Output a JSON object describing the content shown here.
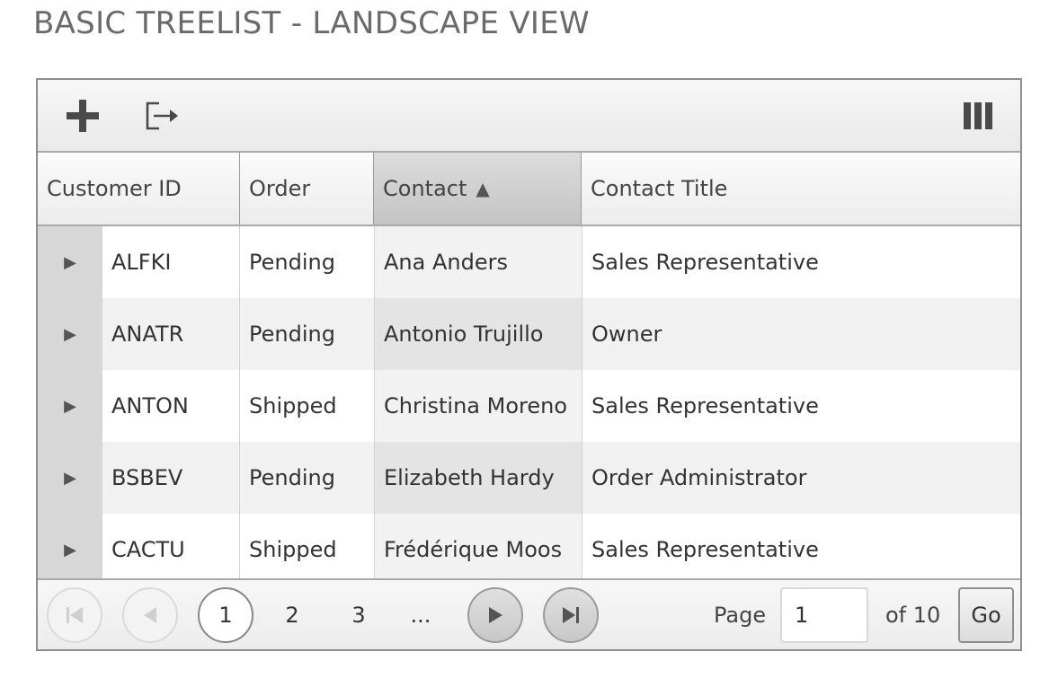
{
  "page": {
    "title": "BASIC TREELIST - LANDSCAPE VIEW"
  },
  "toolbar": {
    "add_icon": "plus-icon",
    "export_icon": "export-icon",
    "columns_icon": "columns-icon"
  },
  "columns": {
    "customer_id": "Customer ID",
    "order": "Order",
    "contact": "Contact",
    "contact_title": "Contact Title",
    "sort_indicator": "▲"
  },
  "rows": [
    {
      "customer_id": "ALFKI",
      "order": "Pending",
      "contact": "Ana Anders",
      "contact_title": "Sales Representative"
    },
    {
      "customer_id": "ANATR",
      "order": "Pending",
      "contact": "Antonio Trujillo",
      "contact_title": "Owner"
    },
    {
      "customer_id": "ANTON",
      "order": "Shipped",
      "contact": "Christina Moreno",
      "contact_title": "Sales Representative"
    },
    {
      "customer_id": "BSBEV",
      "order": "Pending",
      "contact": "Elizabeth Hardy",
      "contact_title": "Order Administrator"
    },
    {
      "customer_id": "CACTU",
      "order": "Shipped",
      "contact": "Frédérique Moos",
      "contact_title": "Sales Representative"
    }
  ],
  "expander_glyph": "▶",
  "pager": {
    "current_page": "1",
    "pages": [
      "2",
      "3"
    ],
    "ellipsis": "...",
    "page_label": "Page",
    "page_input_value": "1",
    "of_label": "of 10",
    "go_label": "Go"
  }
}
